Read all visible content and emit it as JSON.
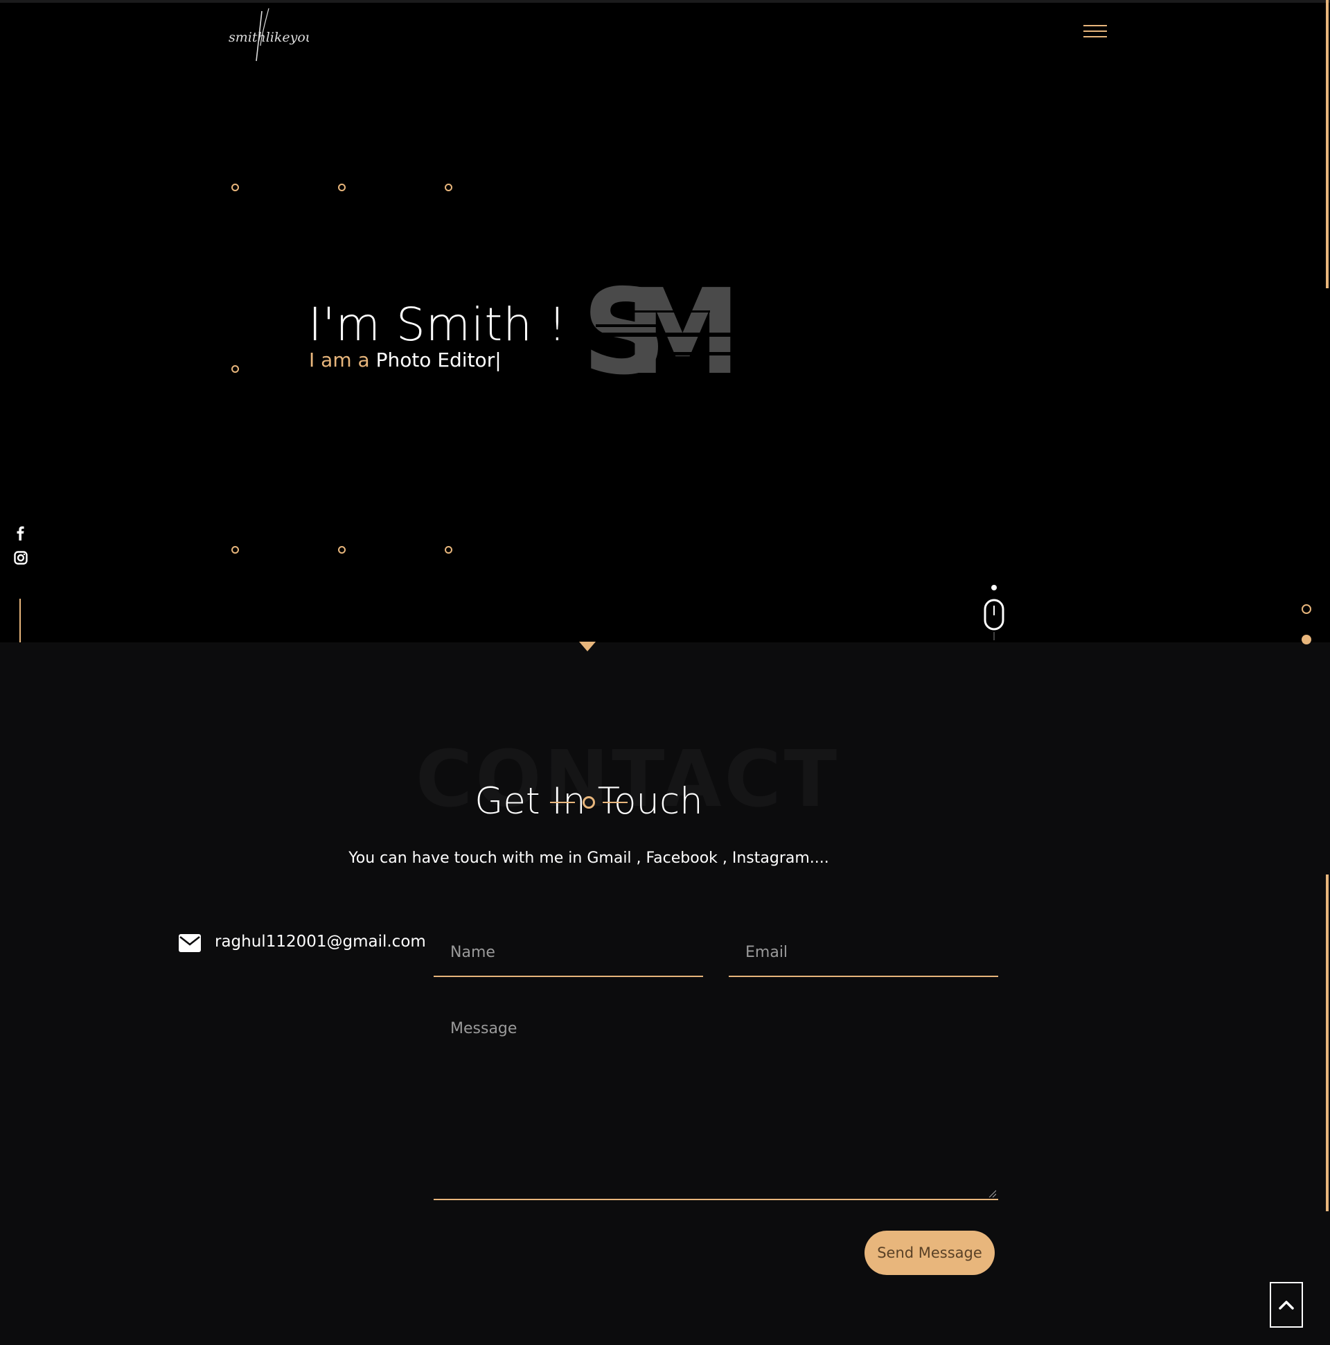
{
  "brand": {
    "logo_text": "smithlikeyou"
  },
  "hero": {
    "title": "I'm Smith !",
    "subtitle_lead": "I am a ",
    "subtitle_role": "Photo Editor",
    "cursor": "|",
    "monogram": "SM"
  },
  "contact": {
    "background_word": "CONTACT",
    "title": "Get In Touch",
    "description": "You can have touch with me in Gmail , Facebook , Instagram....",
    "email": "raghul112001@gmail.com",
    "form": {
      "name_placeholder": "Name",
      "email_placeholder": "Email",
      "message_placeholder": "Message",
      "send_label": "Send Message"
    }
  },
  "icons": {
    "menu": "hamburger-icon",
    "facebook": "facebook-icon",
    "instagram": "instagram-icon",
    "mouse": "mouse-scroll-icon",
    "mail": "envelope-icon",
    "back_to_top": "chevron-up-icon"
  },
  "colors": {
    "accent": "#e8b67c",
    "hero_background": "#000000",
    "contact_background": "#0c0c0d",
    "text": "#ffffff"
  }
}
